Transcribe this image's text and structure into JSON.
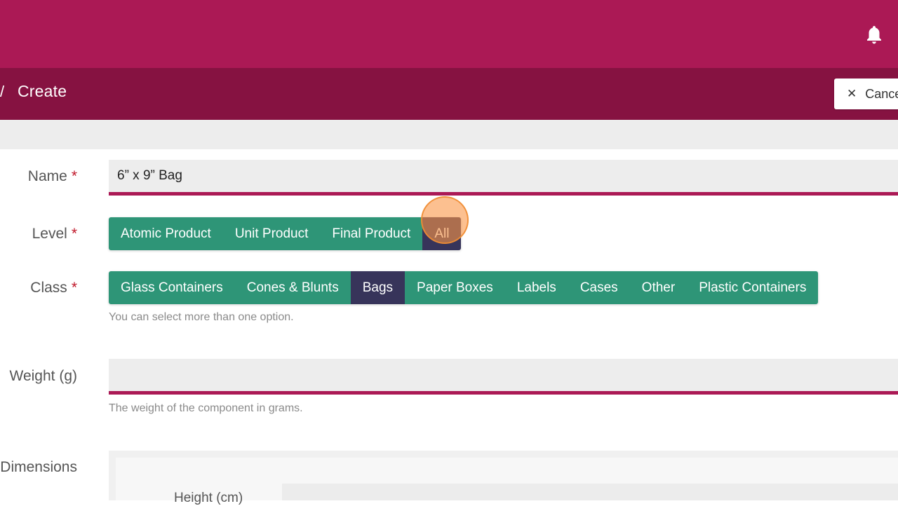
{
  "header": {
    "bell_icon": "bell-icon",
    "breadcrumb_sep": "/",
    "title": "Create",
    "cancel_label": "Cance",
    "cancel_icon": "close-icon",
    "brand_color": "#ab1955",
    "subbar_color": "#861241"
  },
  "form": {
    "name": {
      "label": "Name",
      "required": "*",
      "value": "6” x 9” Bag"
    },
    "level": {
      "label": "Level",
      "required": "*",
      "options": [
        "Atomic Product",
        "Unit Product",
        "Final Product",
        "All"
      ],
      "selected": "All"
    },
    "class": {
      "label": "Class",
      "required": "*",
      "options": [
        "Glass Containers",
        "Cones & Blunts",
        "Bags",
        "Paper Boxes",
        "Labels",
        "Cases",
        "Other",
        "Plastic Containers"
      ],
      "selected": "Bags",
      "help": "You can select more than one option."
    },
    "weight": {
      "label": "Weight (g)",
      "value": "",
      "help": "The weight of the component in grams."
    },
    "dimensions": {
      "label": "Dimensions",
      "height_label": "Height (cm)"
    }
  },
  "colors": {
    "button_green": "#2e9577",
    "button_active": "#37345a"
  }
}
